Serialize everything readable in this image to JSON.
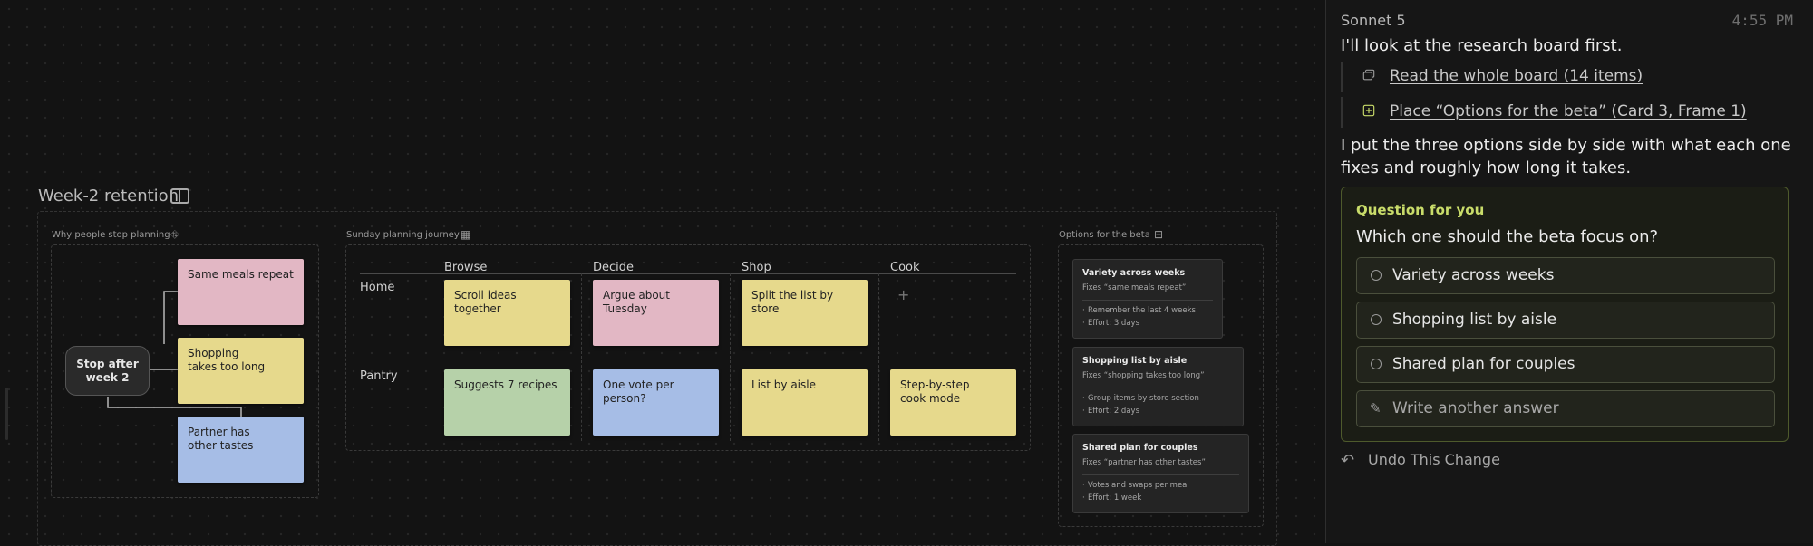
{
  "board": {
    "title": "Week-2 retention",
    "frames": {
      "why": {
        "label": "Why people stop planning",
        "root": "Stop after week 2",
        "causes": [
          "Same meals repeat",
          "Shopping takes too long",
          "Partner has other tastes"
        ]
      },
      "journey": {
        "label": "Sunday planning journey",
        "columns": [
          "Browse",
          "Decide",
          "Shop",
          "Cook"
        ],
        "rows": [
          {
            "label": "Home",
            "cells": [
              "Scroll ideas together",
              "Argue about Tuesday",
              "Split the list by store",
              "+"
            ]
          },
          {
            "label": "Pantry",
            "cells": [
              "Suggests 7 recipes",
              "One vote per person?",
              "List by aisle",
              "Step-by-step cook mode"
            ]
          }
        ]
      },
      "options": {
        "label": "Options for the beta",
        "cards": [
          {
            "title": "Variety across weeks",
            "fixes": "Fixes “same meals repeat”",
            "detail": "Remember the last 4 weeks",
            "effort": "Effort: 3 days"
          },
          {
            "title": "Shopping list by aisle",
            "fixes": "Fixes “shopping takes too long”",
            "detail": "Group items by store section",
            "effort": "Effort: 2 days"
          },
          {
            "title": "Shared plan for couples",
            "fixes": "Fixes “partner has other tastes”",
            "detail": "Votes and swaps per meal",
            "effort": "Effort: 1 week"
          }
        ]
      }
    }
  },
  "chat": {
    "model": "Sonnet 5",
    "time": "4:55 PM",
    "intro": "I'll look at the research board first.",
    "tools": [
      {
        "icon": "read-board-icon",
        "label": "Read the whole board (14 items)"
      },
      {
        "icon": "place-frame-icon",
        "label": "Place “Options for the beta” (Card 3, Frame 1)"
      }
    ],
    "summary": "I put the three options side by side with what each one fixes and roughly how long it takes.",
    "question": {
      "label": "Question for you",
      "text": "Which one should the beta focus on?",
      "options": [
        "Variety across weeks",
        "Shopping list by aisle",
        "Shared plan for couples"
      ],
      "write_other": "Write another answer"
    },
    "undo": "Undo This Change"
  },
  "colors": {
    "yellow_sticky": "#e6d98c",
    "pink_sticky": "#e2b7c4",
    "green_sticky": "#b6d1a9",
    "blue_sticky": "#a6bde6",
    "question_accent": "#c9dc6a"
  }
}
